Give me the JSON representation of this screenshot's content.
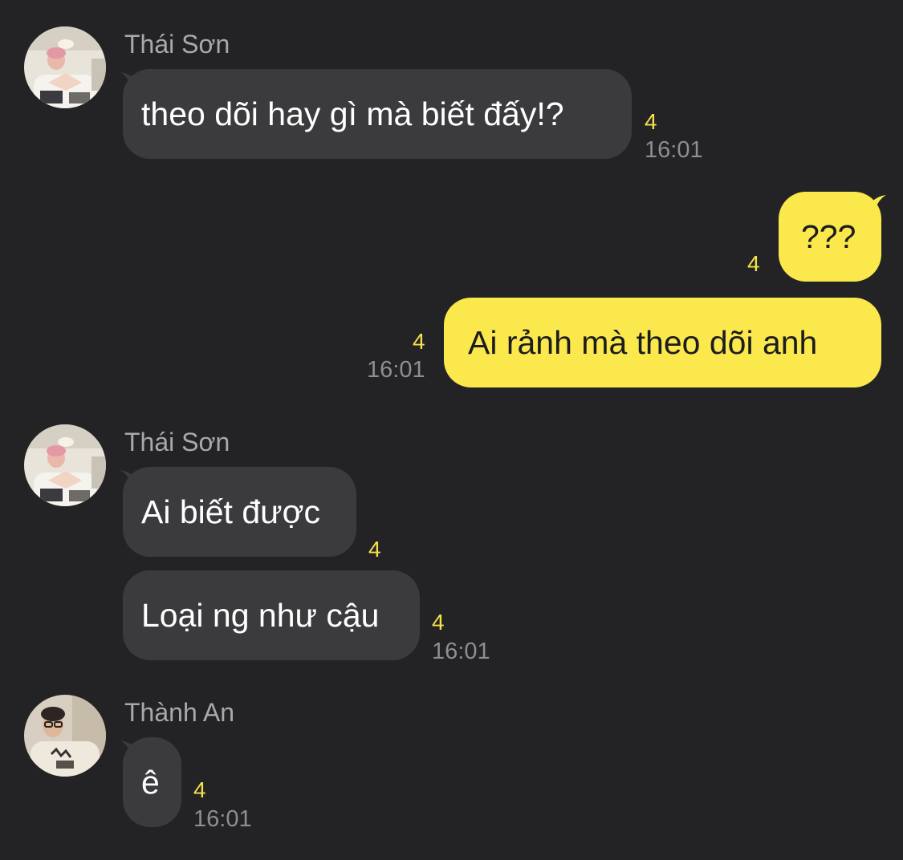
{
  "colors": {
    "background": "#232325",
    "incoming_bubble": "#3b3b3e",
    "outgoing_bubble": "#fae84c",
    "unread_count": "#f4e04a",
    "timestamp": "#8e8e93",
    "sender_name": "#a9a9ad"
  },
  "groups": [
    {
      "sender": "Thái Sơn",
      "messages": [
        {
          "text": "theo dõi hay gì mà biết đấy!?",
          "unread": "4",
          "time": "16:01"
        }
      ]
    },
    {
      "sender": "",
      "messages": [
        {
          "text": "???",
          "unread": "4",
          "time": ""
        },
        {
          "text": "Ai rảnh mà theo dõi anh",
          "unread": "4",
          "time": "16:01"
        }
      ]
    },
    {
      "sender": "Thái Sơn",
      "messages": [
        {
          "text": "Ai biết được",
          "unread": "4",
          "time": ""
        },
        {
          "text": "Loại ng như cậu",
          "unread": "4",
          "time": "16:01"
        }
      ]
    },
    {
      "sender": "Thành An",
      "messages": [
        {
          "text": "ê",
          "unread": "4",
          "time": "16:01"
        }
      ]
    }
  ]
}
